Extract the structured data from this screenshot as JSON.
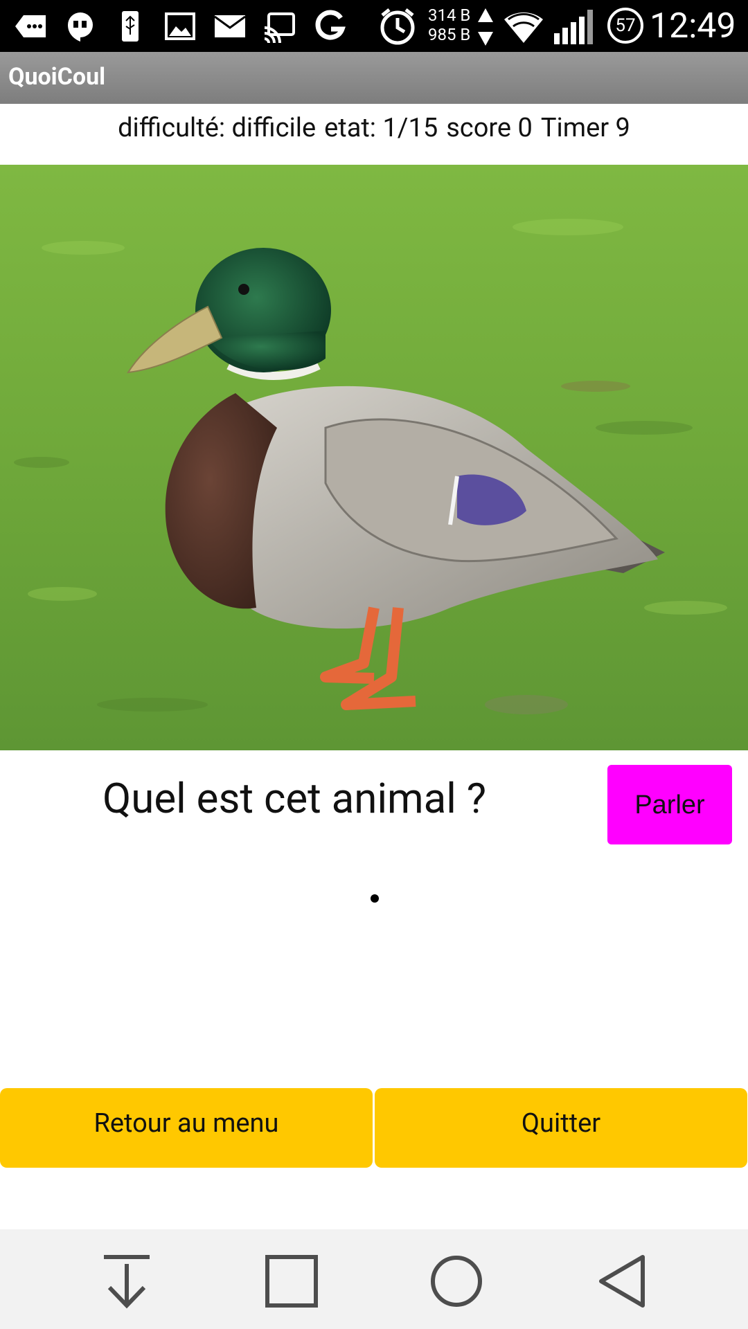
{
  "status_bar": {
    "icons": [
      "more-notifications-icon",
      "hangouts-icon",
      "usb-icon",
      "gallery-icon",
      "email-icon",
      "cast-icon",
      "g-app-icon",
      "alarm-icon"
    ],
    "net_up": "314 B",
    "net_down": "985 B",
    "battery_level": "57",
    "time": "12:49"
  },
  "app": {
    "title": "QuoiCoul"
  },
  "info": {
    "difficulty": "difficulté: difficile",
    "state": "etat: 1/15",
    "score": "score 0",
    "timer": "Timer 9"
  },
  "question": {
    "text": "Quel est cet animal ?",
    "speak_label": "Parler"
  },
  "answer": {
    "text": ""
  },
  "buttons": {
    "menu_label": "Retour au menu",
    "quit_label": "Quitter"
  },
  "colors": {
    "accent_magenta": "#ff00ff",
    "button_yellow": "#ffc800",
    "action_bar": "#8a8a8a"
  },
  "nav_bar": {
    "icons": [
      "hide-keyboard-icon",
      "recents-icon",
      "home-icon",
      "back-icon"
    ]
  }
}
